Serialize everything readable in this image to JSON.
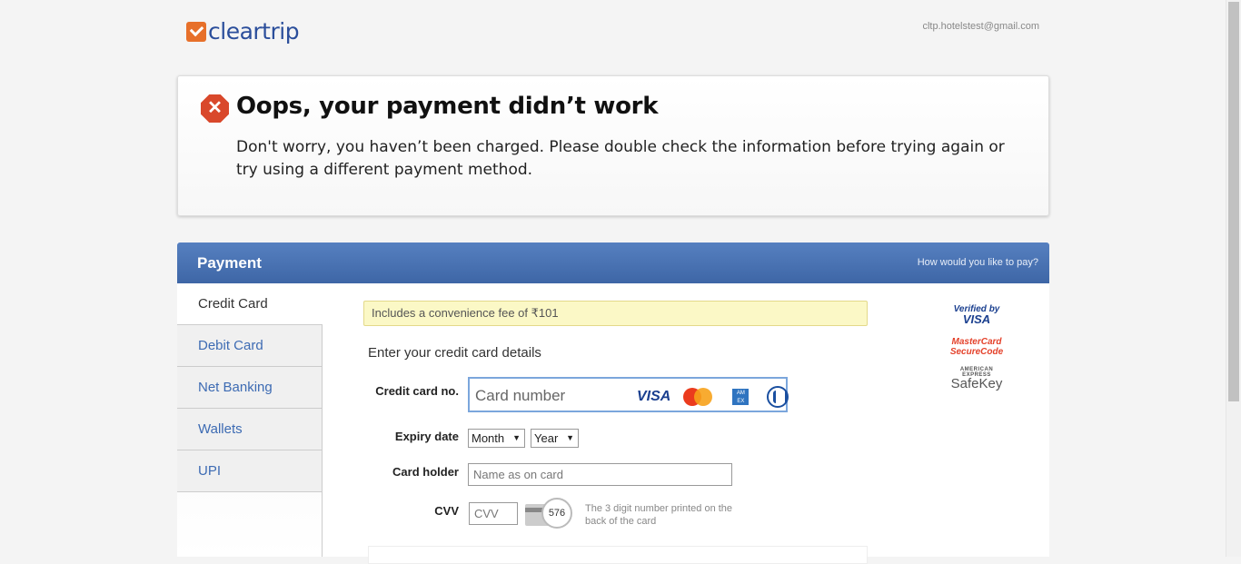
{
  "header": {
    "brand": "cleartrip",
    "user_email": "cltp.hotelstest@gmail.com"
  },
  "error": {
    "icon": "error-octagon-icon",
    "title": "Oops, your payment didn’t work",
    "message": "Don't worry, you haven’t been charged. Please double check the information before trying again or try using a different payment method."
  },
  "payment": {
    "title": "Payment",
    "ask": "How would you like to pay?",
    "tabs": [
      {
        "label": "Credit Card",
        "active": true
      },
      {
        "label": "Debit Card",
        "active": false
      },
      {
        "label": "Net Banking",
        "active": false
      },
      {
        "label": "Wallets",
        "active": false
      },
      {
        "label": "UPI",
        "active": false
      }
    ],
    "fee_notice": "Includes a convenience fee of  ₹101",
    "form_title": "Enter your credit card details",
    "card_no_label": "Credit card no.",
    "card_no_placeholder": "Card number",
    "card_brands": {
      "visa": "VISA",
      "amex": "AM EX"
    },
    "expiry_label": "Expiry date",
    "month_value": "Month",
    "year_value": "Year",
    "holder_label": "Card holder",
    "holder_placeholder": "Name as on card",
    "cvv_label": "CVV",
    "cvv_placeholder": "CVV",
    "cvv_sample": "576",
    "cvv_help": "The 3 digit number printed on the back of the card",
    "trust": {
      "verified_a": "Verified",
      "verified_b": "by",
      "verified_c": "VISA",
      "mc_a": "MasterCard",
      "mc_b": "SecureCode",
      "amex_a": "AMERICAN EXPRESS",
      "amex_b": "SafeKey"
    }
  },
  "colors": {
    "brand_blue": "#2b4e9b",
    "brand_orange": "#e7702a",
    "header_blue": "#4a72b2",
    "error_red": "#d9482b",
    "fee_bg": "#fbf8c6"
  }
}
